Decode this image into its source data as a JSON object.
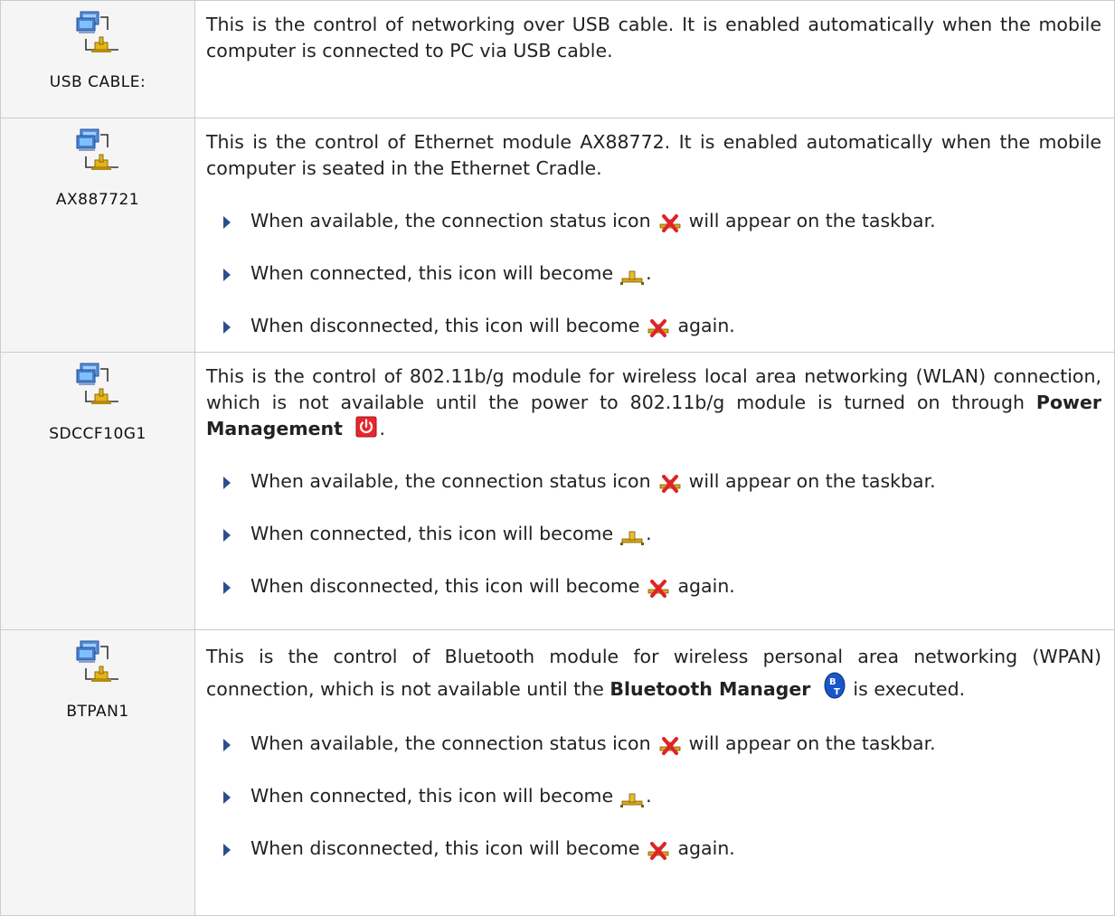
{
  "rows": [
    {
      "label": "USB CABLE:",
      "paragraph": "This is the control of networking over USB cable. It is enabled automatically when the mobile computer is connected to PC via USB cable.",
      "bullets": []
    },
    {
      "label": "AX887721",
      "paragraph": "This is the control of Ethernet module AX88772. It is enabled automatically when the mobile computer is seated in the Ethernet Cradle.",
      "bullets": {
        "available_pre": "When available, the connection status icon",
        "available_post": "will appear on the taskbar.",
        "connected_pre": "When connected, this icon will become",
        "connected_post": ".",
        "disconnected_pre": "When disconnected, this icon will become",
        "disconnected_post": "again."
      }
    },
    {
      "label": "SDCCF10G1",
      "paragraph_pre": "This is the control of 802.11b/g module for wireless local area networking (WLAN) connection, which is not available until the power to 802.11b/g module is turned on through",
      "paragraph_bold": "Power Management",
      "paragraph_post": ".",
      "bullets": {
        "available_pre": "When available, the connection status icon",
        "available_post": "will appear on the taskbar.",
        "connected_pre": "When connected, this icon will become",
        "connected_post": ".",
        "disconnected_pre": "When disconnected, this icon will become",
        "disconnected_post": "again."
      }
    },
    {
      "label": "BTPAN1",
      "paragraph_pre": "This is the control of Bluetooth module for wireless personal area networking (WPAN) connection, which is not available until the",
      "paragraph_bold": "Bluetooth Manager",
      "paragraph_post": "is executed.",
      "bullets": {
        "available_pre": "When available, the connection status icon",
        "available_post": "will appear on the taskbar.",
        "connected_pre": "When connected, this icon will become",
        "connected_post": ".",
        "disconnected_pre": "When disconnected, this icon will become",
        "disconnected_post": "again."
      }
    }
  ],
  "icons": {
    "network": "network-connection-icon",
    "disconnected": "network-disconnected-icon",
    "connected": "network-connected-icon",
    "power": "power-management-icon",
    "bluetooth": "bluetooth-manager-icon"
  },
  "colors": {
    "border": "#c8ccd2",
    "label_bg": "#f5f5f5",
    "bullet": "#2b4f8c"
  }
}
